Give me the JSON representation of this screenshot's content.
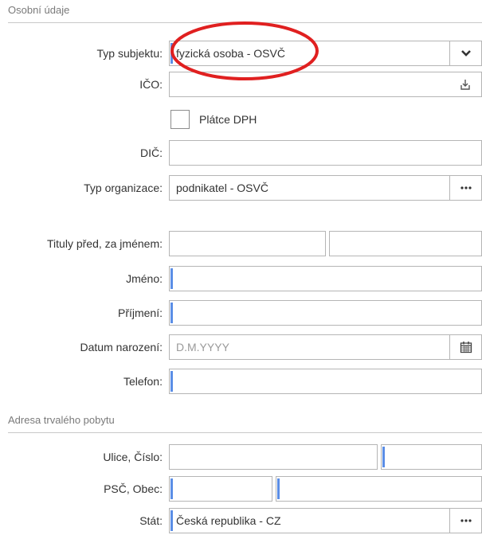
{
  "sections": {
    "personal": "Osobní údaje",
    "address": "Adresa trvalého pobytu"
  },
  "fields": {
    "typ_subjektu": {
      "label": "Typ subjektu:",
      "value": "fyzická osoba - OSVČ"
    },
    "ico": {
      "label": "IČO:",
      "value": ""
    },
    "platce_dph": {
      "label": "Plátce DPH",
      "checked": false
    },
    "dic": {
      "label": "DIČ:",
      "value": ""
    },
    "typ_organizace": {
      "label": "Typ organizace:",
      "value": "podnikatel - OSVČ"
    },
    "tituly": {
      "label": "Tituly před, za jménem:",
      "before": "",
      "after": ""
    },
    "jmeno": {
      "label": "Jméno:",
      "value": ""
    },
    "prijmeni": {
      "label": "Příjmení:",
      "value": ""
    },
    "datum_narozeni": {
      "label": "Datum narození:",
      "placeholder": "D.M.YYYY"
    },
    "telefon": {
      "label": "Telefon:",
      "value": ""
    },
    "ulice_cislo": {
      "label": "Ulice, Číslo:",
      "street": "",
      "number": ""
    },
    "psc_obec": {
      "label": "PSČ, Obec:",
      "psc": "",
      "obec": ""
    },
    "stat": {
      "label": "Stát:",
      "value": "Česká republika - CZ"
    }
  },
  "icons": {
    "dropdown": "chevron-down-icon",
    "import": "import-icon",
    "more": "ellipsis-icon",
    "calendar": "calendar-icon"
  },
  "colors": {
    "required_marker": "#5b8ee6",
    "annotation": "#e02020",
    "border": "#b5b5b5"
  }
}
